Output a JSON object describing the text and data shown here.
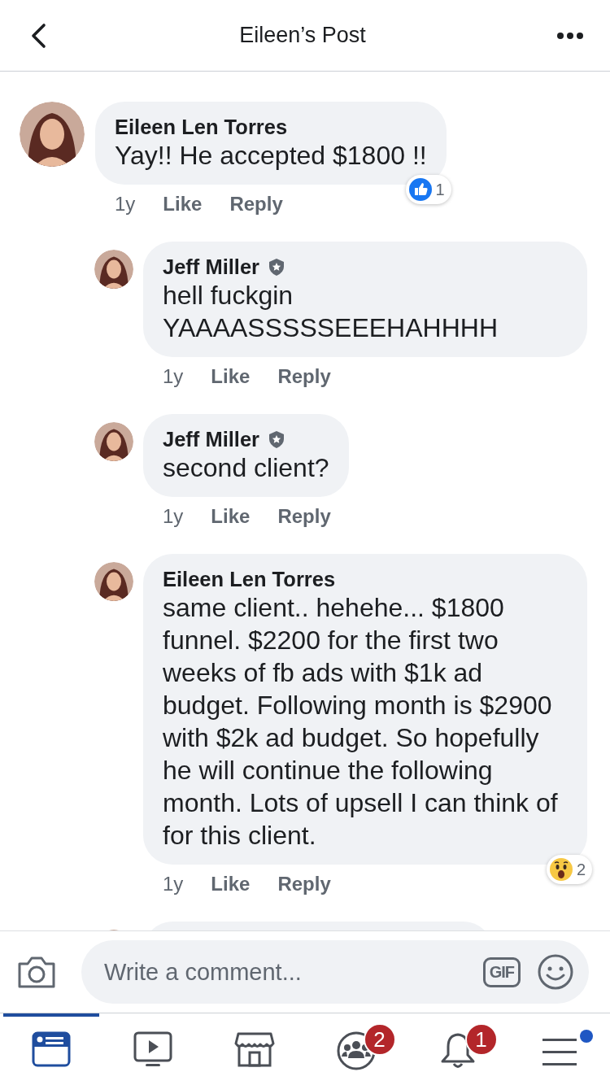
{
  "header": {
    "title": "Eileen’s Post"
  },
  "comments": [
    {
      "author": "Eileen Len Torres",
      "badge": false,
      "text": "Yay!! He accepted $1800 !!",
      "time": "1y",
      "actions": [
        "Like",
        "Reply"
      ],
      "reaction": {
        "kind": "like",
        "count": "1"
      },
      "children": [
        {
          "author": "Jeff Miller",
          "badge": true,
          "text": "hell fuckgin YAAAASSSSSEEEHAHHHH",
          "time": "1y",
          "actions": [
            "Like",
            "Reply"
          ]
        },
        {
          "author": "Jeff Miller",
          "badge": true,
          "text": "second client?",
          "time": "1y",
          "actions": [
            "Like",
            "Reply"
          ]
        },
        {
          "author": "Eileen Len Torres",
          "badge": false,
          "text": "same client.. hehehe... $1800 funnel. $2200 for the first two weeks of fb ads with $1k ad budget. Following month is $2900 with $2k ad budget. So hopefully he will continue the following month.  Lots of upsell I can think of for this client.",
          "time": "1y",
          "actions": [
            "Like",
            "Reply"
          ],
          "reaction": {
            "kind": "wow",
            "count": "2"
          }
        }
      ]
    }
  ],
  "composer": {
    "placeholder": "Write a comment...",
    "gif_label": "GIF"
  },
  "tabs": [
    {
      "kind": "feed",
      "selected": true
    },
    {
      "kind": "watch",
      "selected": false
    },
    {
      "kind": "marketplace",
      "selected": false
    },
    {
      "kind": "groups",
      "selected": false,
      "badge": "2"
    },
    {
      "kind": "notifications",
      "selected": false,
      "badge": "1"
    },
    {
      "kind": "menu",
      "selected": false,
      "dot": true
    }
  ]
}
